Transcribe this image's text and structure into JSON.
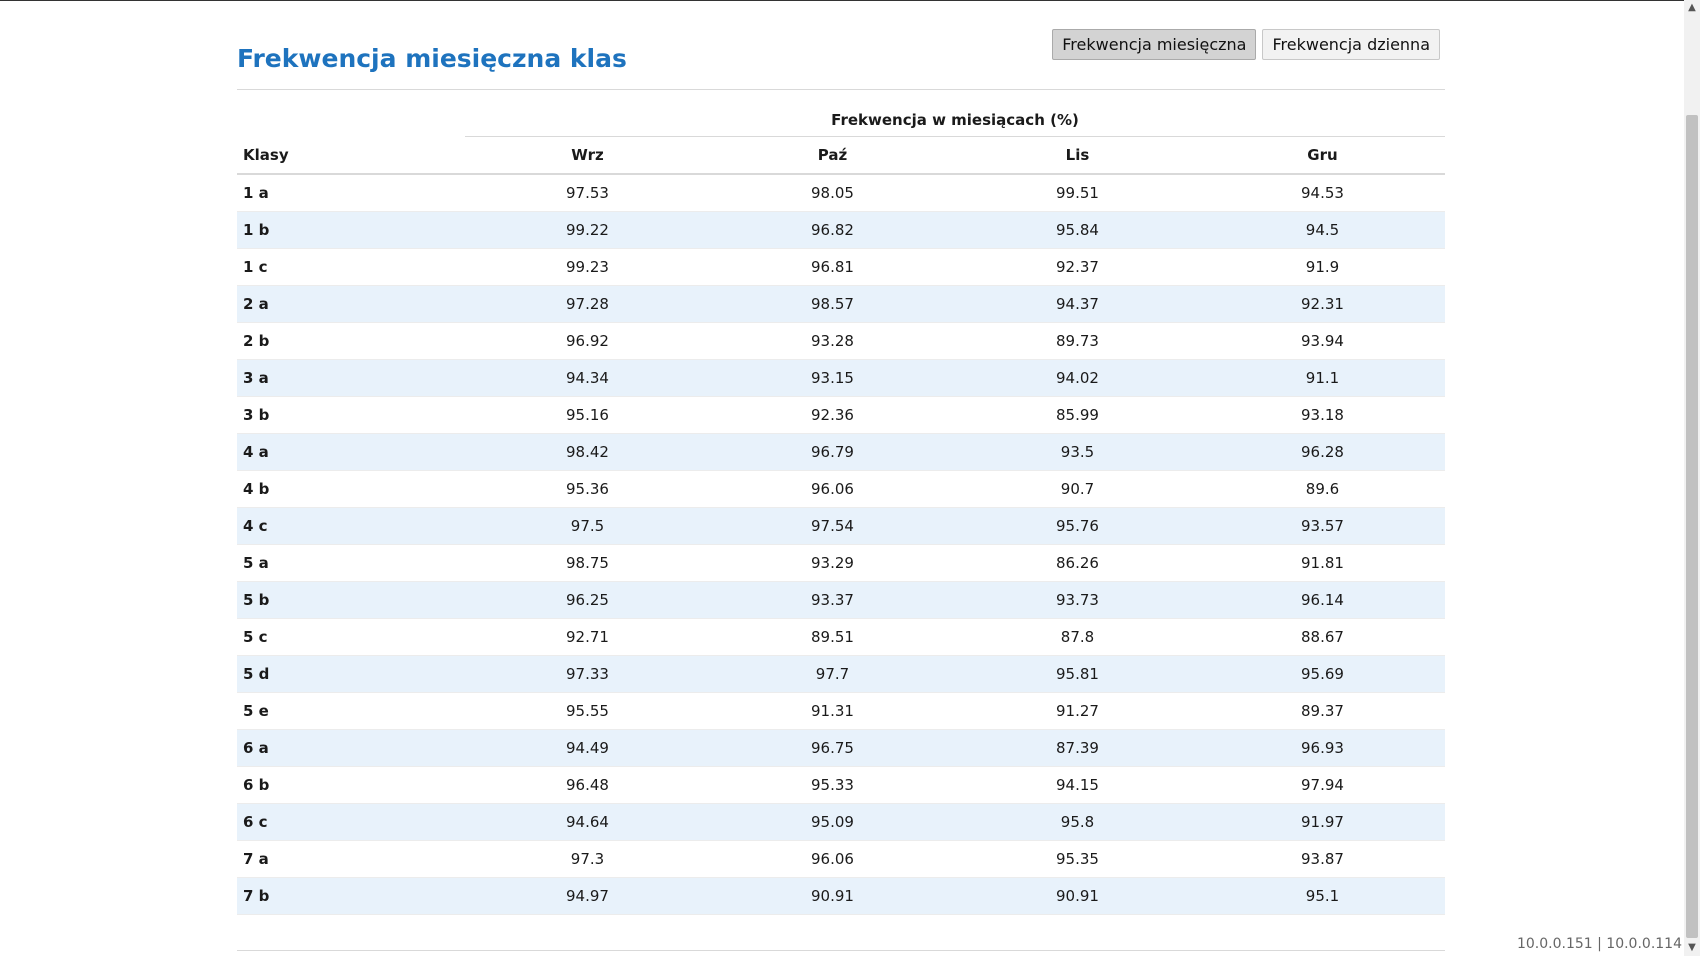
{
  "page": {
    "title": "Frekwencja miesięczna klas",
    "buttons": [
      "Frekwencja miesięczna",
      "Frekwencja dzienna"
    ],
    "active_button": 0
  },
  "table": {
    "group_header": "Frekwencja w miesiącach (%)",
    "columns": [
      "Klasy",
      "Wrz",
      "Paź",
      "Lis",
      "Gru"
    ],
    "rows": [
      [
        "1 a",
        "97.53",
        "98.05",
        "99.51",
        "94.53"
      ],
      [
        "1 b",
        "99.22",
        "96.82",
        "95.84",
        "94.5"
      ],
      [
        "1 c",
        "99.23",
        "96.81",
        "92.37",
        "91.9"
      ],
      [
        "2 a",
        "97.28",
        "98.57",
        "94.37",
        "92.31"
      ],
      [
        "2 b",
        "96.92",
        "93.28",
        "89.73",
        "93.94"
      ],
      [
        "3 a",
        "94.34",
        "93.15",
        "94.02",
        "91.1"
      ],
      [
        "3 b",
        "95.16",
        "92.36",
        "85.99",
        "93.18"
      ],
      [
        "4 a",
        "98.42",
        "96.79",
        "93.5",
        "96.28"
      ],
      [
        "4 b",
        "95.36",
        "96.06",
        "90.7",
        "89.6"
      ],
      [
        "4 c",
        "97.5",
        "97.54",
        "95.76",
        "93.57"
      ],
      [
        "5 a",
        "98.75",
        "93.29",
        "86.26",
        "91.81"
      ],
      [
        "5 b",
        "96.25",
        "93.37",
        "93.73",
        "96.14"
      ],
      [
        "5 c",
        "92.71",
        "89.51",
        "87.8",
        "88.67"
      ],
      [
        "5 d",
        "97.33",
        "97.7",
        "95.81",
        "95.69"
      ],
      [
        "5 e",
        "95.55",
        "91.31",
        "91.27",
        "89.37"
      ],
      [
        "6 a",
        "94.49",
        "96.75",
        "87.39",
        "96.93"
      ],
      [
        "6 b",
        "96.48",
        "95.33",
        "94.15",
        "97.94"
      ],
      [
        "6 c",
        "94.64",
        "95.09",
        "95.8",
        "91.97"
      ],
      [
        "7 a",
        "97.3",
        "96.06",
        "95.35",
        "93.87"
      ],
      [
        "7 b",
        "94.97",
        "90.91",
        "90.91",
        "95.1"
      ]
    ]
  },
  "footer": {
    "ip": "10.0.0.151 | 10.0.0.114"
  },
  "icons": {
    "scroll_up": "chevron-up-icon",
    "scroll_down": "chevron-down-icon"
  },
  "colors": {
    "title": "#1e73be",
    "row_alt": "#e8f2fb",
    "active_button": "#d3d3d3"
  }
}
